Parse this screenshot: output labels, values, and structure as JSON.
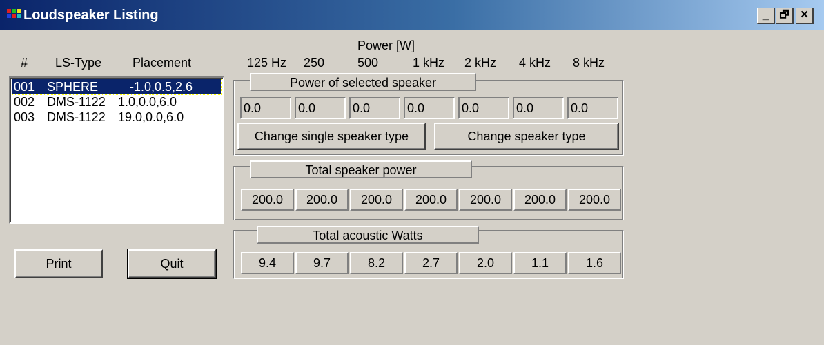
{
  "window": {
    "title": "Loudspeaker Listing",
    "controls": [
      "_",
      "🗗",
      "✕"
    ]
  },
  "columns": {
    "num": "#",
    "type": "LS-Type",
    "placement": "Placement",
    "power_header": "Power [W]",
    "frequencies": [
      "125 Hz",
      "250",
      "500",
      "1 kHz",
      "2 kHz",
      "4 kHz",
      "8 kHz"
    ]
  },
  "speakers": [
    {
      "num": "001",
      "type": "SPHERE",
      "placement": "-1.0,0.5,2.6",
      "selected": true
    },
    {
      "num": "002",
      "type": "DMS-1122",
      "placement": "1.0,0.0,6.0",
      "selected": false
    },
    {
      "num": "003",
      "type": "DMS-1122",
      "placement": "19.0,0.0,6.0",
      "selected": false
    }
  ],
  "selected_power": {
    "caption": "Power of selected speaker",
    "values": [
      "0.0",
      "0.0",
      "0.0",
      "0.0",
      "0.0",
      "0.0",
      "0.0"
    ],
    "change_single_label": "Change single speaker type",
    "change_type_label": "Change speaker type"
  },
  "total_power": {
    "caption": "Total speaker power",
    "values": [
      "200.0",
      "200.0",
      "200.0",
      "200.0",
      "200.0",
      "200.0",
      "200.0"
    ]
  },
  "acoustic_watts": {
    "caption": "Total acoustic Watts",
    "values": [
      "9.4",
      "9.7",
      "8.2",
      "2.7",
      "2.0",
      "1.1",
      "1.6"
    ]
  },
  "buttons": {
    "print_label": "Print",
    "quit_label": "Quit"
  },
  "colors": {
    "titlebar_start": "#0a246a",
    "titlebar_end": "#a6caf0",
    "face": "#d4d0c8",
    "selection": "#0a246a"
  }
}
